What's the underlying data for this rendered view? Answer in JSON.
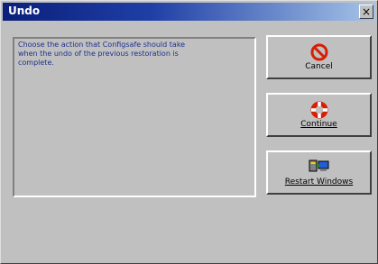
{
  "window": {
    "title": "Undo",
    "close_label": "×"
  },
  "message": {
    "text": "Choose the action that Configsafe should take\nwhen the undo of the previous restoration is\ncomplete."
  },
  "buttons": {
    "cancel": {
      "label": "Cancel",
      "icon": "no-symbol-icon"
    },
    "continue": {
      "label": "Continue",
      "icon": "life-ring-icon"
    },
    "restart": {
      "label": "Restart Windows",
      "icon": "computer-icon"
    }
  },
  "colors": {
    "title_bar_start": "#0a1f7a",
    "title_bar_end": "#a6c4e8",
    "message_text": "#1f2f8a",
    "icon_red": "#d81e05"
  }
}
